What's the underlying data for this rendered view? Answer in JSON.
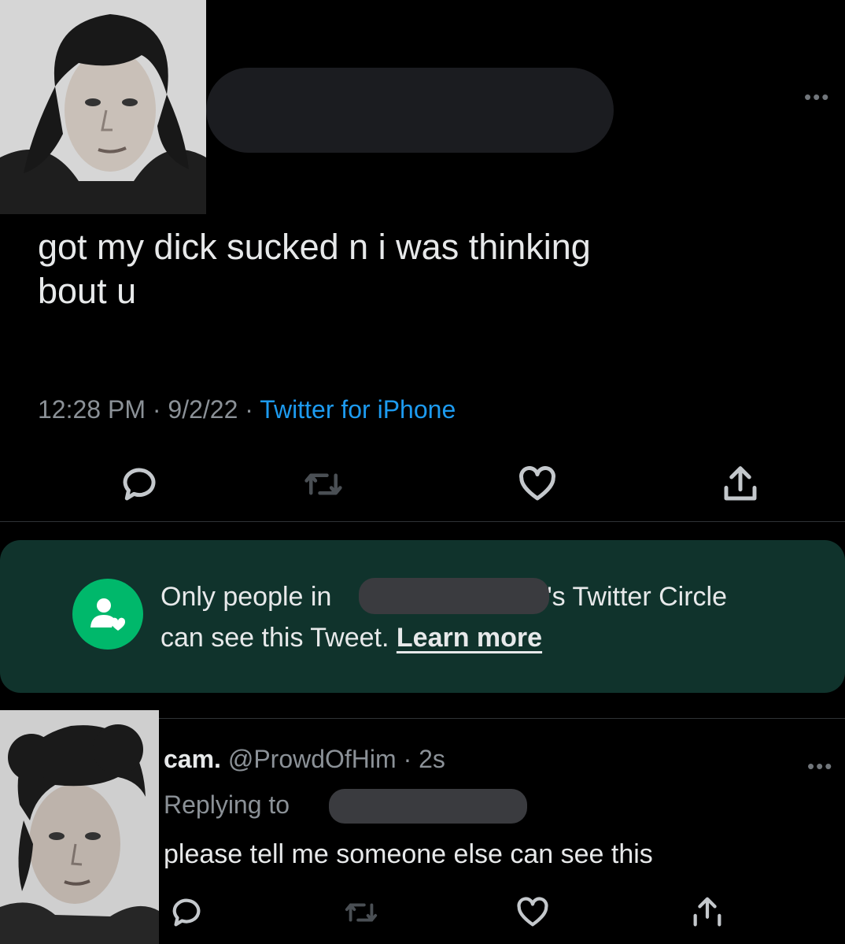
{
  "tweet": {
    "text_line1": "got my dick sucked n i was thinking",
    "text_line2": "bout u",
    "time": "12:28 PM",
    "date": "9/2/22",
    "source": "Twitter for iPhone",
    "sep": "·"
  },
  "circle_notice": {
    "prefix": "Only people in",
    "suffix": "e's Twitter Circle",
    "line2": "can see this Tweet.",
    "link": "Learn more"
  },
  "reply": {
    "name": "cam.",
    "handle": "@ProwdOfHim",
    "time": "2s",
    "replying_to": "Replying to",
    "text": "please tell me someone else can see this"
  },
  "icons": [
    "reply-icon",
    "retweet-icon",
    "like-icon",
    "share-icon",
    "more-icon",
    "circle-icon"
  ],
  "colors": {
    "background": "#000000",
    "link": "#1d9bf0",
    "banner": "#10332c",
    "circle_green": "#00b86b",
    "muted": "#8b9197"
  }
}
